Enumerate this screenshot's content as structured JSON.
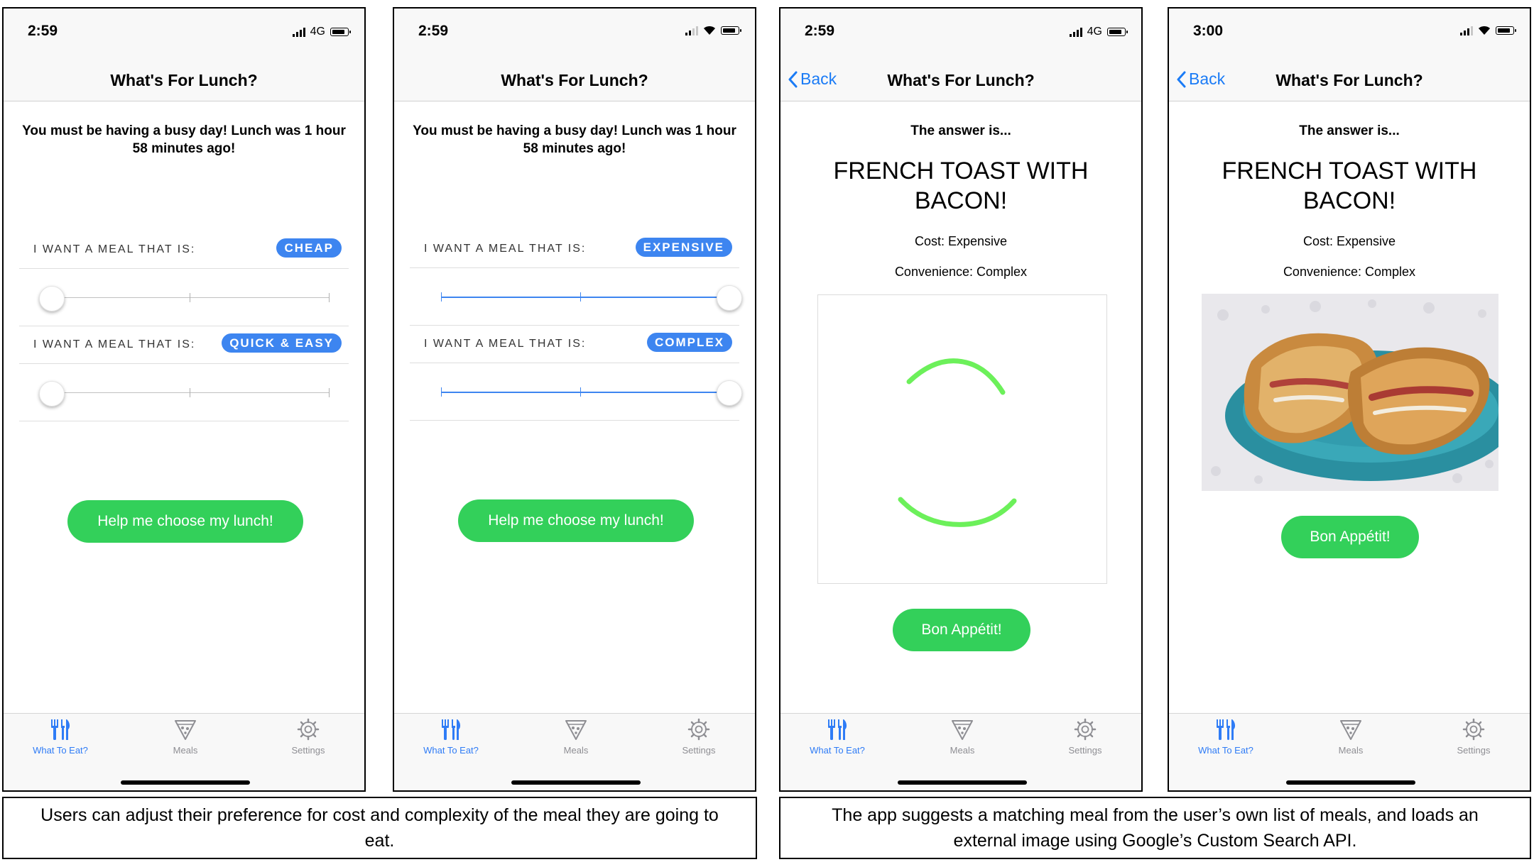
{
  "colors": {
    "accent": "#1a7bf6",
    "pill": "#3d85f0",
    "button_green": "#33d05a",
    "spinner_green": "#6cf05a"
  },
  "screens": [
    {
      "time": "2:59",
      "network": "4G",
      "title": "What's For Lunch?",
      "message": "You must be having a busy day! Lunch was 1 hour 58 minutes ago!",
      "cost_label": "I WANT A MEAL THAT IS:",
      "cost_value": "CHEAP",
      "cost_level": 0,
      "complexity_label": "I WANT A MEAL THAT IS:",
      "complexity_value": "QUICK & EASY",
      "complexity_level": 0,
      "button": "Help me choose my lunch!"
    },
    {
      "time": "2:59",
      "title": "What's For Lunch?",
      "message": "You must be having a busy day! Lunch was 1 hour 58 minutes ago!",
      "cost_label": "I WANT A MEAL THAT IS:",
      "cost_value": "EXPENSIVE",
      "cost_level": 1,
      "complexity_label": "I WANT A MEAL THAT IS:",
      "complexity_value": "COMPLEX",
      "complexity_level": 1,
      "button": "Help me choose my lunch!"
    },
    {
      "time": "2:59",
      "network": "4G",
      "back": "Back",
      "title": "What's For Lunch?",
      "answer_label": "The answer is...",
      "meal": "FRENCH TOAST WITH BACON!",
      "cost": "Cost: Expensive",
      "convenience": "Convenience: Complex",
      "button": "Bon Appétit!"
    },
    {
      "time": "3:00",
      "back": "Back",
      "title": "What's For Lunch?",
      "answer_label": "The answer is...",
      "meal": "FRENCH TOAST WITH BACON!",
      "cost": "Cost: Expensive",
      "convenience": "Convenience: Complex",
      "button": "Bon Appétit!"
    }
  ],
  "tabs": [
    {
      "label": "What To Eat?",
      "icon": "fork-knife-icon"
    },
    {
      "label": "Meals",
      "icon": "pizza-slice-icon"
    },
    {
      "label": "Settings",
      "icon": "gear-icon"
    }
  ],
  "captions": {
    "left": "Users can adjust their preference for cost and complexity of the meal they are going to eat.",
    "right": "The app suggests a matching meal from the user’s own list of meals, and loads an external image using Google’s Custom Search API."
  }
}
